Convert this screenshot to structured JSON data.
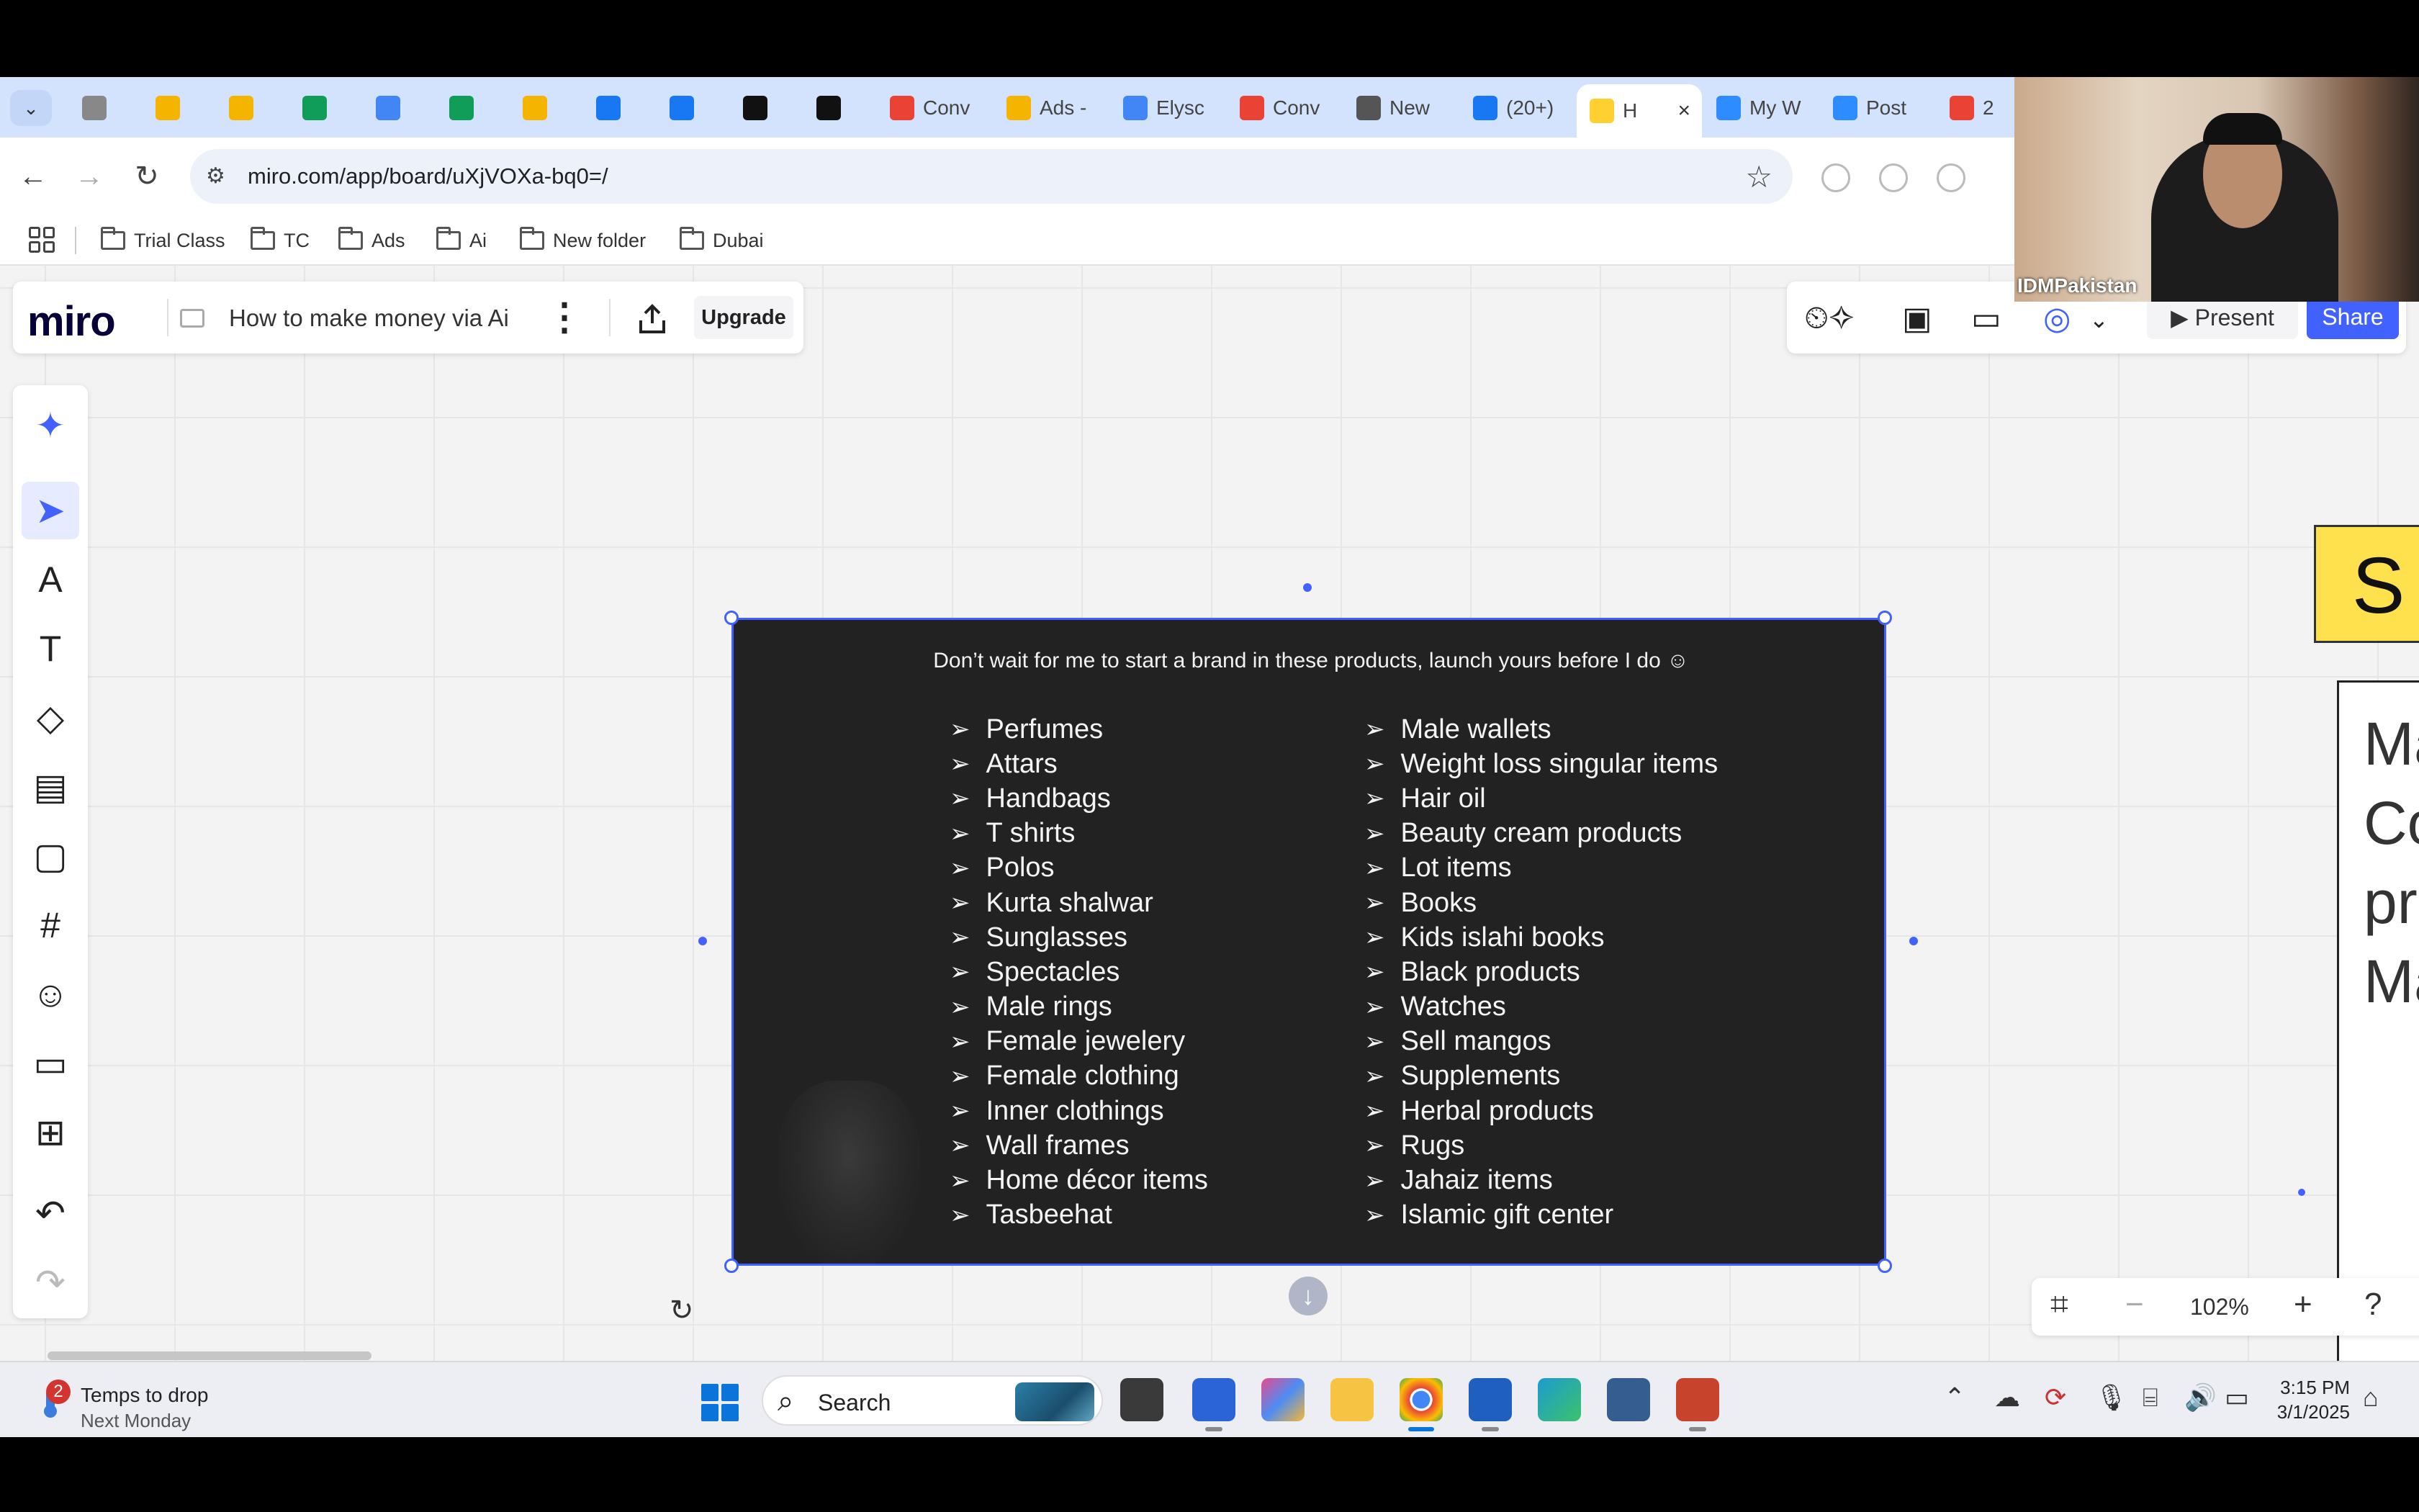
{
  "browser": {
    "tabs": [
      {
        "label": "",
        "icon": "globe-icon"
      },
      {
        "label": "",
        "icon": "google-ads-icon"
      },
      {
        "label": "",
        "icon": "google-ads-icon"
      },
      {
        "label": "",
        "icon": "sheets-icon"
      },
      {
        "label": "",
        "icon": "docs-icon"
      },
      {
        "label": "",
        "icon": "sheets-icon"
      },
      {
        "label": "",
        "icon": "google-ads-icon"
      },
      {
        "label": "",
        "icon": "instagram-icon"
      },
      {
        "label": "",
        "icon": "facebook-icon"
      },
      {
        "label": "",
        "icon": "threads-icon"
      },
      {
        "label": "",
        "icon": "threads-icon"
      },
      {
        "label": "Conv",
        "icon": "google-icon"
      },
      {
        "label": "Ads -",
        "icon": "google-ads-icon"
      },
      {
        "label": "Elysc",
        "icon": "docs-icon"
      },
      {
        "label": "Conv",
        "icon": "google-icon"
      },
      {
        "label": "New",
        "icon": "chrome-icon"
      },
      {
        "label": "(20+)",
        "icon": "facebook-icon"
      },
      {
        "label": "H",
        "icon": "miro-icon",
        "active": true
      },
      {
        "label": "My W",
        "icon": "zoom-icon"
      },
      {
        "label": "Post",
        "icon": "zoom-icon"
      },
      {
        "label": "2",
        "icon": "google-icon"
      }
    ],
    "url": "miro.com/app/board/uXjVOXa-bq0=/",
    "bookmarks": [
      "Trial Class",
      "TC",
      "Ads",
      "Ai",
      "New folder",
      "Dubai"
    ]
  },
  "miro": {
    "logo": "miro",
    "board_title": "How to make money via Ai",
    "upgrade_label": "Upgrade",
    "present_label": "Present",
    "share_label": "Share",
    "zoom_level": "102%",
    "accent": "#4262ff"
  },
  "slide": {
    "heading": "Don’t wait for me to start a brand in these products, launch yours before I do ☺",
    "left_items": [
      "Perfumes",
      "Attars",
      "Handbags",
      "T shirts",
      "Polos",
      "Kurta shalwar",
      "Sunglasses",
      "Spectacles",
      "Male rings",
      "Female jewelery",
      "Female clothing",
      "Inner clothings",
      "Wall frames",
      "Home décor items",
      "Tasbeehat"
    ],
    "right_items": [
      "Male wallets",
      "Weight loss singular items",
      "Hair oil",
      "Beauty cream products",
      "Lot items",
      "Books",
      "Kids islahi books",
      "Black products",
      "Watches",
      "Sell mangos",
      "Supplements",
      "Herbal products",
      "Rugs",
      "Jahaiz items",
      "Islamic gift center"
    ]
  },
  "offscreen": {
    "sticky_letter": "S",
    "card_lines": [
      "Ma",
      "Co",
      "pr",
      "Ma"
    ]
  },
  "taskbar": {
    "weather_badge": "2",
    "weather_title": "Temps to drop",
    "weather_sub": "Next Monday",
    "search_label": "Search",
    "time": "3:15 PM",
    "date": "3/1/2025"
  },
  "webcam": {
    "name": "IDMPakistan"
  }
}
